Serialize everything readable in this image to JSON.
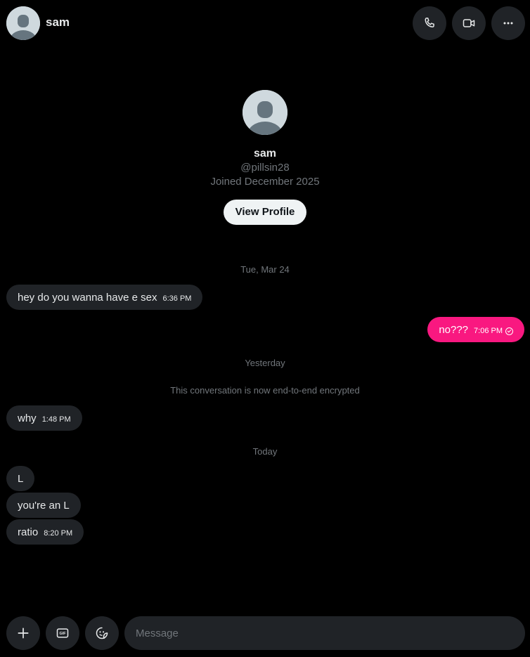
{
  "header": {
    "name": "sam",
    "icons": [
      "avatar",
      "phone-icon",
      "video-icon",
      "more-icon"
    ]
  },
  "profile": {
    "name": "sam",
    "handle": "@pillsin28",
    "joined": "Joined December 2025",
    "view_profile_label": "View Profile"
  },
  "messages": {
    "sep_1": "Tue, Mar 24",
    "m1": {
      "text": "hey do you wanna have e sex",
      "time": "6:36 PM"
    },
    "m2": {
      "text": "no???",
      "time": "7:06 PM"
    },
    "sep_2": "Yesterday",
    "notice": "This conversation is now end-to-end encrypted",
    "m3": {
      "text": "why",
      "time": "1:48 PM"
    },
    "sep_3": "Today",
    "m4": {
      "text": "L"
    },
    "m5": {
      "text": "you're an L"
    },
    "m6": {
      "text": "ratio",
      "time": "8:20 PM"
    }
  },
  "composer": {
    "placeholder": "Message",
    "gif_label": "GIF",
    "icons": [
      "plus-icon",
      "gif-icon",
      "emoji-icon"
    ]
  },
  "colors": {
    "background": "#000000",
    "incoming_bubble": "#202327",
    "outgoing_bubble": "#f91880",
    "muted_text": "#71767b"
  }
}
